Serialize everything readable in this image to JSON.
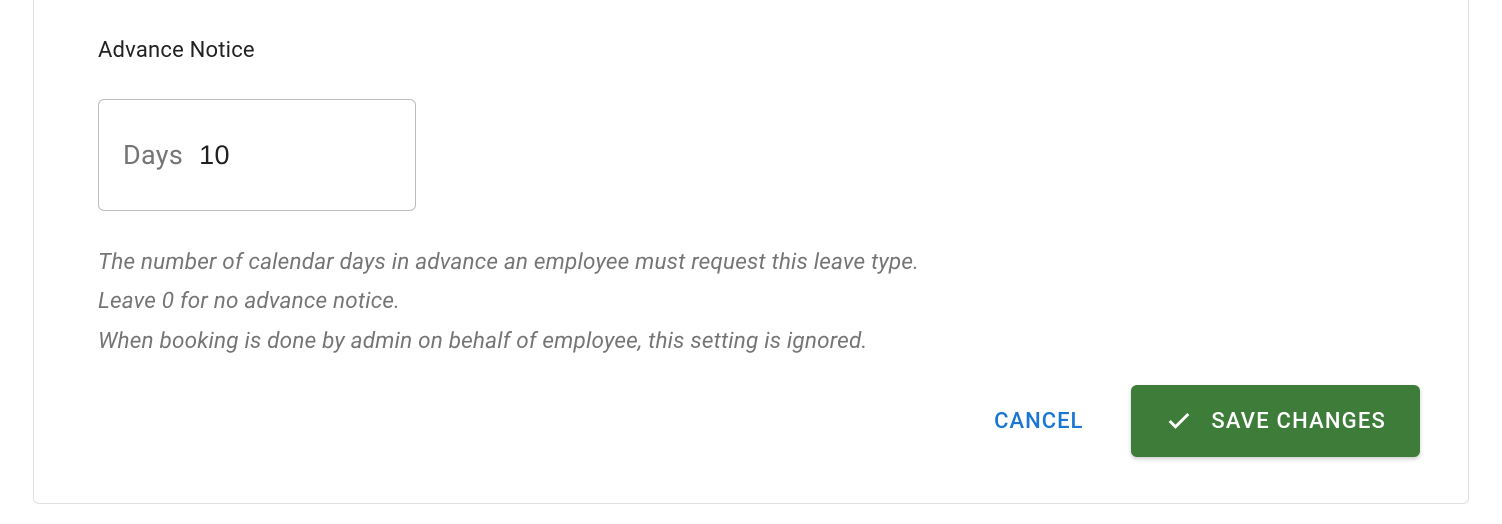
{
  "field": {
    "label": "Advance Notice",
    "prefix": "Days",
    "value": "10"
  },
  "help": {
    "line1": "The number of calendar days in advance an employee must request this leave type.",
    "line2": "Leave 0 for no advance notice.",
    "line3": "When booking is done by admin on behalf of employee, this setting is ignored."
  },
  "actions": {
    "cancel": "CANCEL",
    "save": "SAVE CHANGES"
  }
}
